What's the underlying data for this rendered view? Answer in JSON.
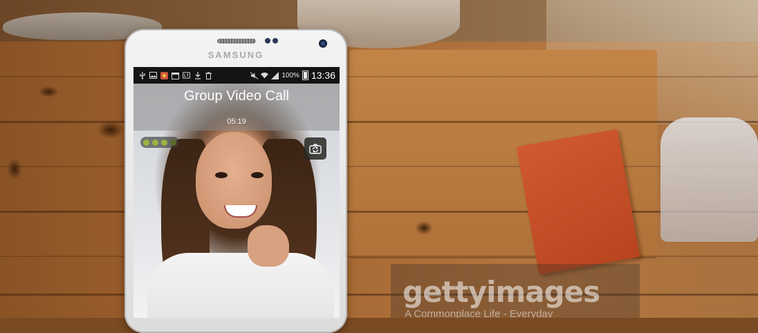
{
  "background": {
    "watermark": "gettyimages",
    "watermark_sub": "A Commonplace Life - Everyday"
  },
  "phone": {
    "brand": "SAMSUNG",
    "status_bar": {
      "battery": "100%",
      "time": "13:36",
      "icons": [
        "usb-icon",
        "image-icon",
        "app-icon",
        "calendar-icon",
        "lte-icon",
        "download-icon",
        "trash-icon",
        "mute-icon",
        "wifi-icon",
        "signal-icon"
      ]
    },
    "call": {
      "title": "Group Video Call",
      "timer": "05:19",
      "signal_level": 3,
      "signal_max": 4
    },
    "colors": {
      "signal_on": "#9ab340",
      "status_bg": "#141414"
    }
  }
}
